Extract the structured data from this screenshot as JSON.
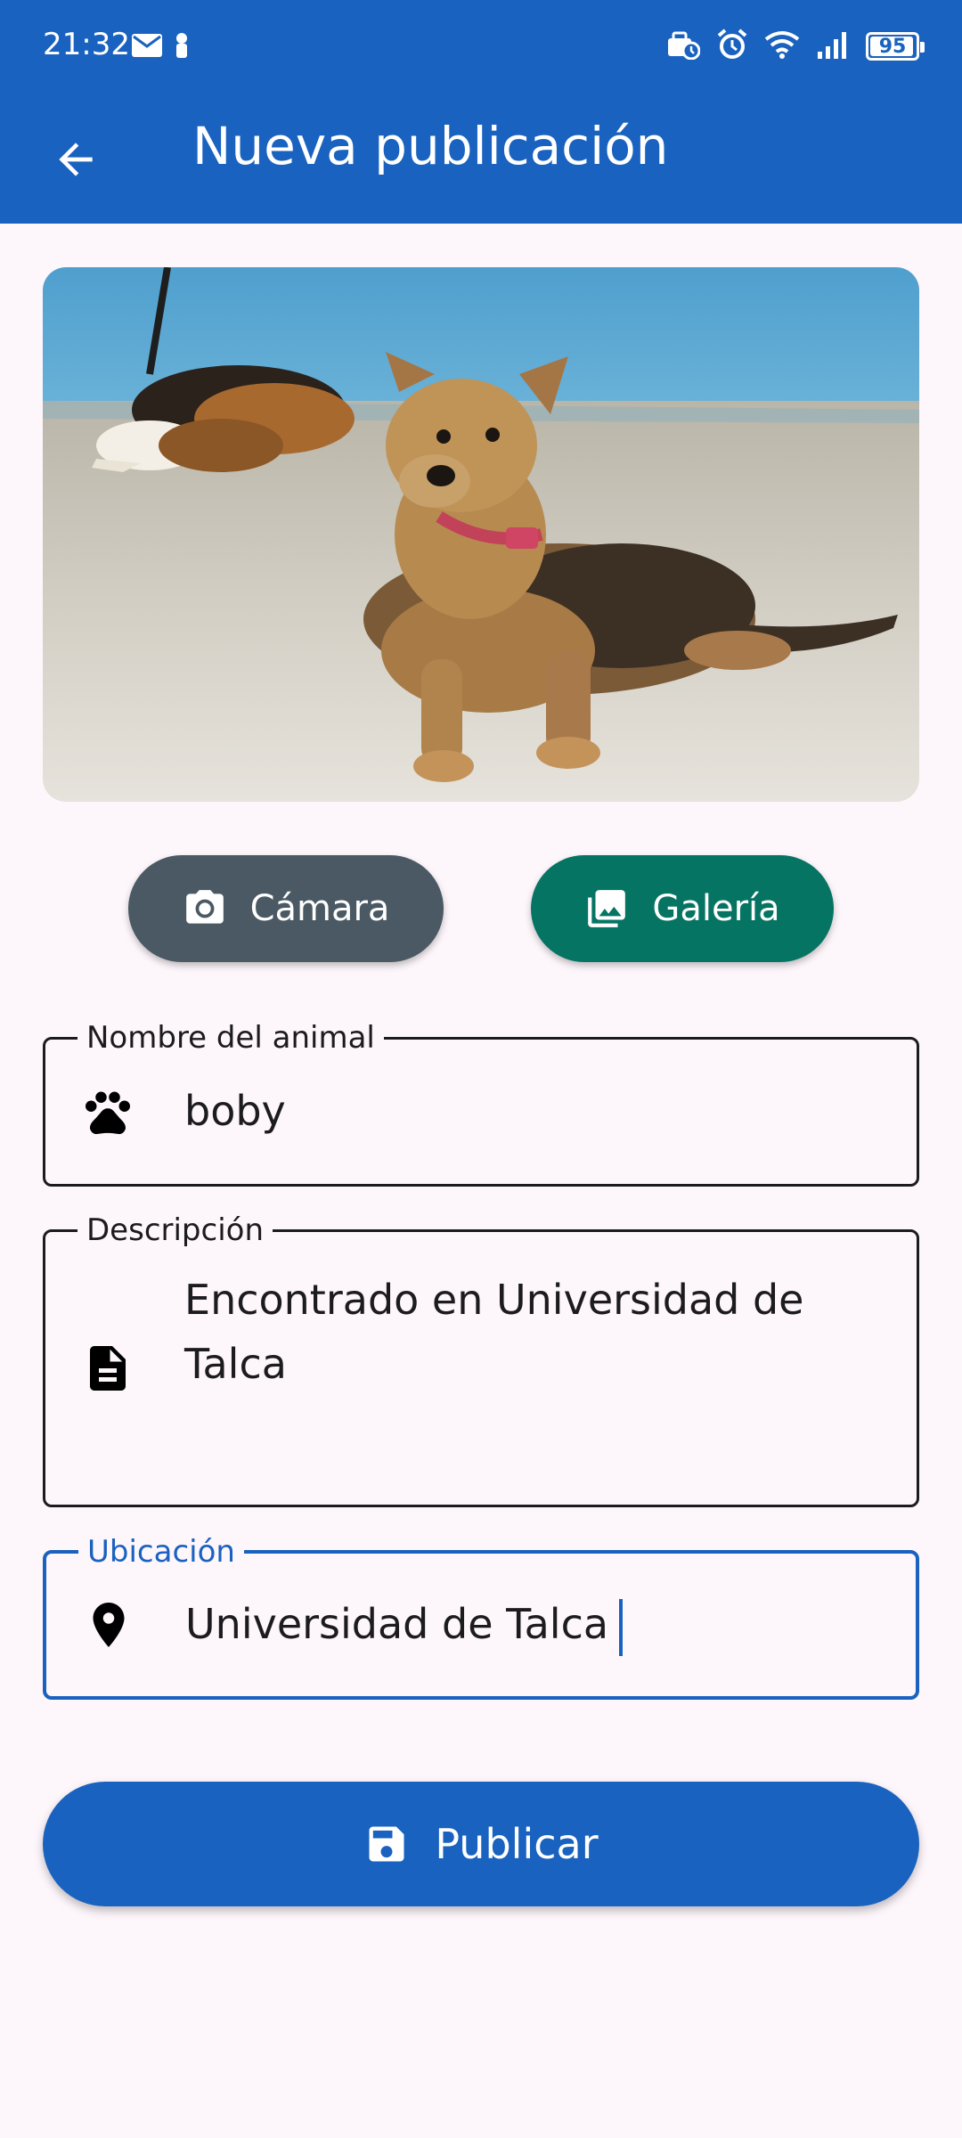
{
  "status_bar": {
    "time": "21:32",
    "battery_level": "95",
    "battery_fraction": 0.95,
    "left_icons": [
      "mail-icon",
      "notification-icon"
    ],
    "right_icons": [
      "data-saver-icon",
      "alarm-icon",
      "wifi-icon",
      "signal-icon",
      "battery-icon"
    ]
  },
  "toolbar": {
    "back_icon": "arrow-back-icon",
    "title": "Nueva publicación"
  },
  "photo": {
    "description_icon": "dog-photo"
  },
  "actions": {
    "camera_label": "Cámara",
    "camera_icon": "camera-icon",
    "gallery_label": "Galería",
    "gallery_icon": "gallery-icon"
  },
  "form": {
    "name": {
      "label": "Nombre del animal",
      "value": "boby",
      "icon": "paw-icon"
    },
    "description": {
      "label": "Descripción",
      "value": "Encontrado en Universidad de Talca",
      "icon": "document-icon"
    },
    "location": {
      "label": "Ubicación",
      "value": "Universidad de Talca",
      "icon": "location-pin-icon"
    }
  },
  "publish": {
    "label": "Publicar",
    "icon": "save-icon"
  },
  "colors": {
    "primary": "#1a62bf",
    "camera_button": "#4a5963",
    "gallery_button": "#067463",
    "background": "#fdf6fb"
  }
}
